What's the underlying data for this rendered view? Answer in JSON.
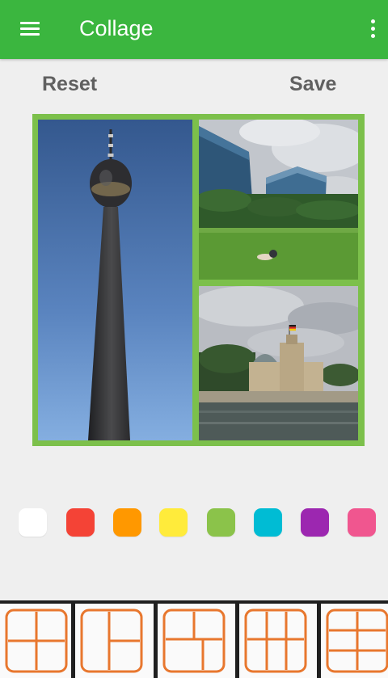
{
  "appbar": {
    "title": "Collage",
    "menu_icon": "hamburger-menu-icon",
    "overflow_icon": "more-vert-icon",
    "color": "#3bb63f"
  },
  "actions": {
    "reset_label": "Reset",
    "save_label": "Save"
  },
  "collage": {
    "border_color": "#7cc04b",
    "photos": [
      {
        "name": "tv-tower-photo"
      },
      {
        "name": "glass-buildings-park-photo"
      },
      {
        "name": "reichstag-river-photo"
      }
    ]
  },
  "colors": [
    "#ffffff",
    "#f44336",
    "#ff9800",
    "#ffeb3b",
    "#8bc34a",
    "#00bcd4",
    "#9c27b0",
    "#f0568f"
  ],
  "layouts": {
    "stroke_color": "#e8772e",
    "items": [
      "layout-grid-2x2",
      "layout-left-full-right-split",
      "layout-top-split-bottom-full",
      "layout-top-full-bottom-three",
      "layout-rows-2x2"
    ]
  }
}
